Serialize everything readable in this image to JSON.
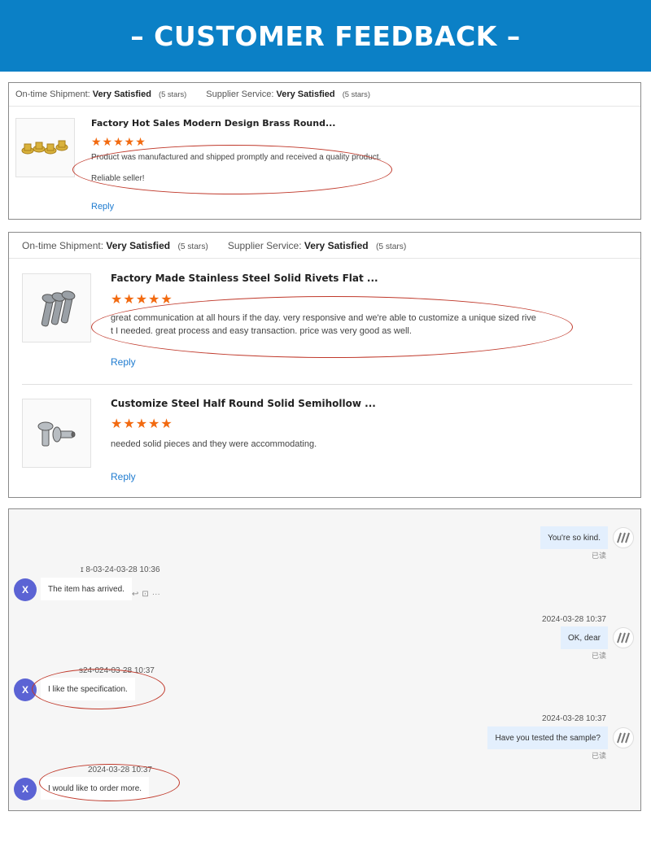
{
  "banner": {
    "title": "– CUSTOMER FEEDBACK –",
    "bg_color": "#0b80c6"
  },
  "card1": {
    "shipment_label": "On-time Shipment:",
    "shipment_value": "Very Satisfied",
    "shipment_stars": "(5 stars)",
    "service_label": "Supplier Service:",
    "service_value": "Very Satisfied",
    "service_stars": "(5 stars)",
    "reviews": [
      {
        "title": "Factory Hot Sales Modern Design Brass Round...",
        "stars": "★★★★★",
        "text_line1": "Product was manufactured and shipped promptly and received a quality product.",
        "text_line2": "Reliable seller!",
        "reply": "Reply",
        "rating": 5
      }
    ]
  },
  "card2": {
    "shipment_label": "On-time Shipment:",
    "shipment_value": "Very Satisfied",
    "shipment_stars": "(5 stars)",
    "service_label": "Supplier Service:",
    "service_value": "Very Satisfied",
    "service_stars": "(5 stars)",
    "reviews": [
      {
        "title": "Factory Made Stainless Steel Solid Rivets Flat ...",
        "stars": "★★★★★",
        "text_line1": "great communication at all hours if the day. very responsive and we're able to customize a unique sized rive",
        "text_line2": "t I needed. great process and easy transaction. price was very good as well.",
        "reply": "Reply",
        "rating": 5
      },
      {
        "title": "Customize Steel Half Round Solid Semihollow ...",
        "stars": "★★★★★",
        "text_line1": "needed solid pieces and they were accommodating.",
        "reply": "Reply",
        "rating": 5
      }
    ]
  },
  "chat": {
    "messages": [
      {
        "dir": "out",
        "text": "You're so kind.",
        "read": "已读"
      },
      {
        "dir": "in",
        "timestamp": "ɪ 8-03-24-03-28 10:36",
        "text": "The item has arrived.",
        "avatar": "X"
      },
      {
        "dir": "out",
        "timestamp": "2024-03-28 10:37",
        "text": "OK, dear",
        "read": "已读"
      },
      {
        "dir": "in",
        "timestamp": "s24-024-03-28 10:37",
        "text": "I like the specification.",
        "avatar": "X"
      },
      {
        "dir": "out",
        "timestamp": "2024-03-28 10:37",
        "text": "Have you tested the sample?",
        "read": "已读"
      },
      {
        "dir": "in",
        "timestamp": "2024-03-28 10:37",
        "text": "I would like to order more.",
        "avatar": "X"
      }
    ],
    "actions": {
      "reply": "↩",
      "quote": "⊡",
      "more": "···"
    }
  },
  "colors": {
    "star": "#f26a10",
    "link": "#1e7bd0",
    "annotation": "#c0392b",
    "avatar": "#5b63d4"
  }
}
